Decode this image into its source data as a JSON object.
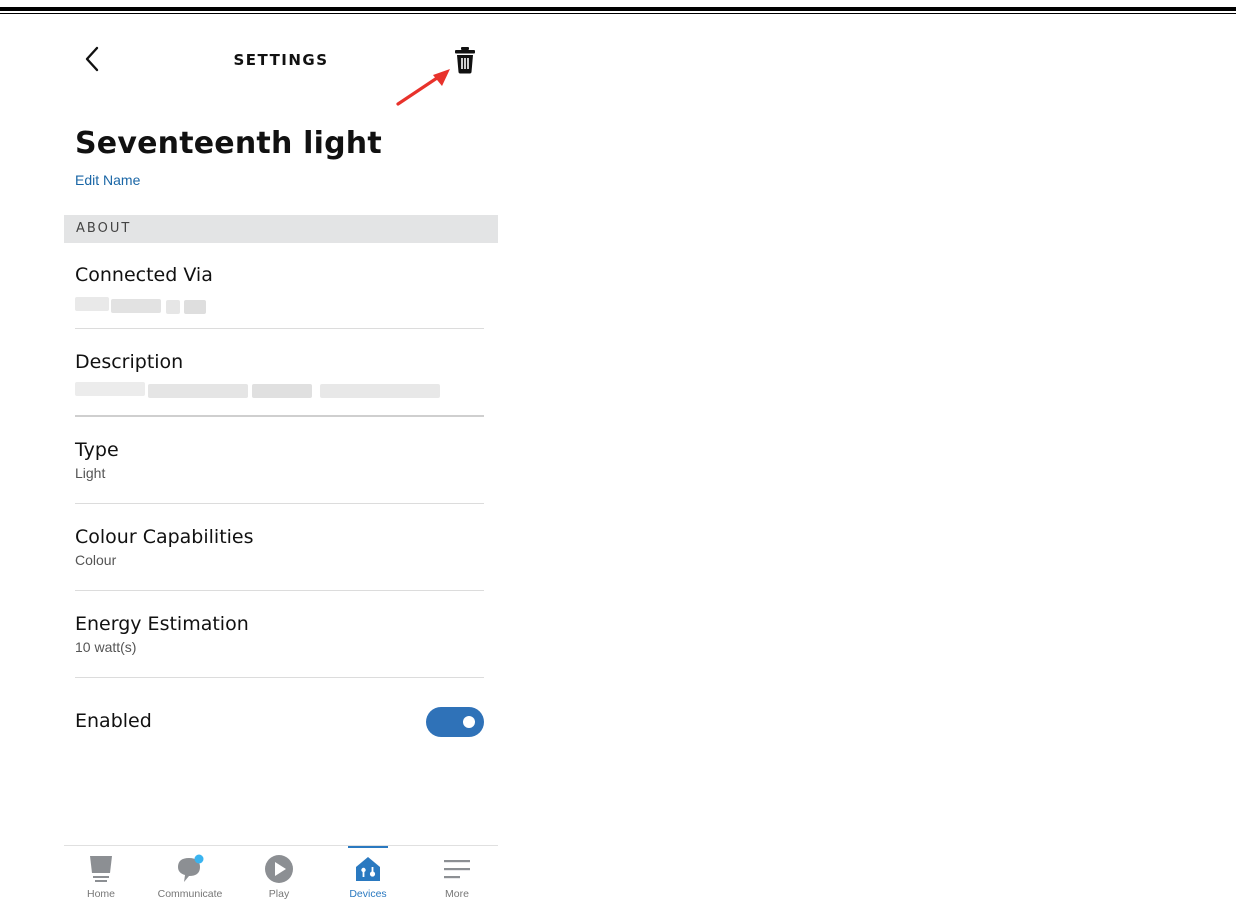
{
  "header": {
    "title": "SETTINGS"
  },
  "device": {
    "name": "Seventeenth light",
    "edit_label": "Edit Name"
  },
  "section": {
    "title": "ABOUT"
  },
  "rows": {
    "connected": {
      "label": "Connected Via"
    },
    "description": {
      "label": "Description"
    },
    "type": {
      "label": "Type",
      "value": "Light"
    },
    "colour": {
      "label": "Colour Capabilities",
      "value": "Colour"
    },
    "energy": {
      "label": "Energy Estimation",
      "value": "10 watt(s)"
    },
    "enabled": {
      "label": "Enabled",
      "state": "on"
    }
  },
  "tabs": [
    {
      "label": "Home",
      "icon": "home-icon"
    },
    {
      "label": "Communicate",
      "icon": "communicate-icon"
    },
    {
      "label": "Play",
      "icon": "play-icon"
    },
    {
      "label": "Devices",
      "icon": "devices-icon",
      "active": true
    },
    {
      "label": "More",
      "icon": "more-icon"
    }
  ],
  "colors": {
    "accent": "#2f72b8",
    "link": "#1a66a6",
    "annotation_arrow": "#e8322b"
  }
}
